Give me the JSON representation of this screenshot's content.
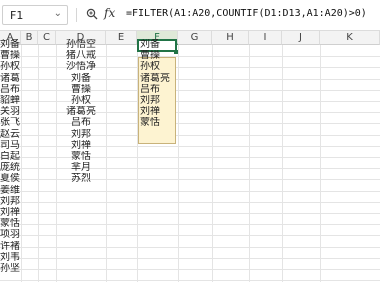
{
  "formula_bar": {
    "name_box": "F1",
    "zoom_icon": "zoom-icon",
    "fx_label": "fx",
    "formula": "=FILTER(A1:A20,COUNTIF(D1:D13,A1:A20)>0)"
  },
  "columns": [
    "A",
    "B",
    "C",
    "D",
    "E",
    "F",
    "G",
    "H",
    "I",
    "J",
    "K"
  ],
  "active_column": "F",
  "columnA": [
    "刘备",
    "曹操",
    "孙权",
    "诸葛亮",
    "吕布",
    "貂蝉",
    "关羽",
    "张飞",
    "赵云",
    "司马懿",
    "白起",
    "庞统",
    "夏侯惇",
    "姜维",
    "刘邦",
    "刘禅",
    "蒙恬",
    "项羽",
    "许褚",
    "刘韦",
    "孙坚"
  ],
  "columnD": [
    "孙悟空",
    "猪八戒",
    "沙悟净",
    "刘备",
    "曹操",
    "孙权",
    "诸葛亮",
    "吕布",
    "刘邦",
    "刘禅",
    "蒙恬",
    "芈月",
    "苏烈"
  ],
  "columnF": [
    "刘备",
    "曹操",
    "孙权",
    "诸葛亮",
    "吕布",
    "刘邦",
    "刘禅",
    "蒙恬"
  ]
}
